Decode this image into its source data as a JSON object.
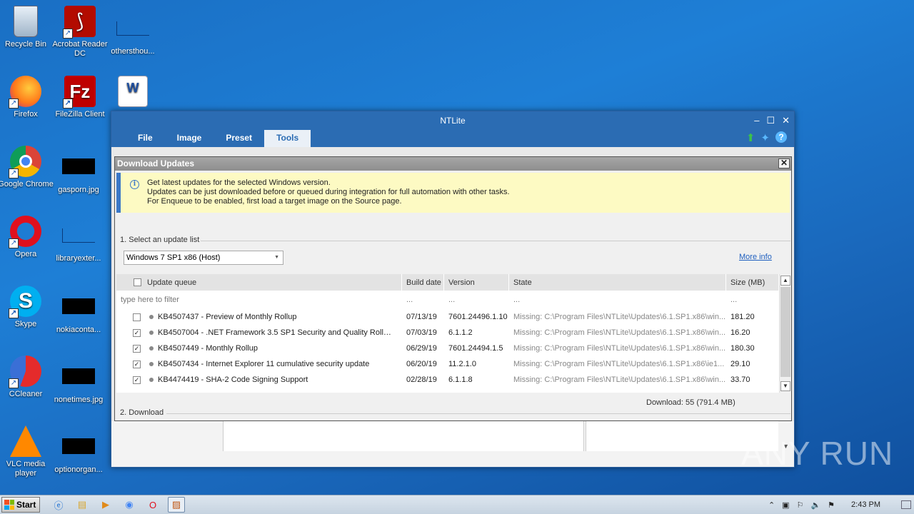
{
  "desktop": {
    "icons": [
      {
        "label": "Recycle Bin"
      },
      {
        "label": "Acrobat Reader DC"
      },
      {
        "label": "othersthou..."
      },
      {
        "label": "Firefox"
      },
      {
        "label": "FileZilla Client"
      },
      {
        "label": ""
      },
      {
        "label": "Google Chrome"
      },
      {
        "label": "gasporn.jpg"
      },
      {
        "label": "Opera"
      },
      {
        "label": "libraryexter..."
      },
      {
        "label": "Skype"
      },
      {
        "label": "nokiaconta..."
      },
      {
        "label": "CCleaner"
      },
      {
        "label": "nonetimes.jpg"
      },
      {
        "label": "VLC media player"
      },
      {
        "label": "optionorgan..."
      }
    ]
  },
  "ntlite": {
    "title": "NTLite",
    "tabs": [
      "File",
      "Image",
      "Preset",
      "Tools"
    ],
    "active_tab": "Tools"
  },
  "dialog": {
    "title": "Download Updates",
    "info_lines": [
      "Get latest updates for the selected Windows version.",
      "Updates can be just downloaded before or queued during integration for full automation with other tasks.",
      "For Enqueue to be enabled, first load a target image on the Source page."
    ],
    "section1": "1. Select an update list",
    "selected_list": "Windows 7 SP1 x86 (Host)",
    "more_info": "More info",
    "columns": [
      "Update queue",
      "Build date",
      "Version",
      "State",
      "Size (MB)"
    ],
    "filter_placeholder": "type here to filter",
    "filter_dots": "...",
    "rows": [
      {
        "checked": false,
        "name": "KB4507437 - Preview of Monthly Rollup",
        "date": "07/13/19",
        "version": "7601.24496.1.10",
        "state": "Missing: C:\\Program Files\\NTLite\\Updates\\6.1.SP1.x86\\win...",
        "size": "181.20"
      },
      {
        "checked": true,
        "name": "KB4507004 - .NET Framework 3.5 SP1 Security and Quality Rollup ...",
        "date": "07/03/19",
        "version": "6.1.1.2",
        "state": "Missing: C:\\Program Files\\NTLite\\Updates\\6.1.SP1.x86\\win...",
        "size": "16.20"
      },
      {
        "checked": true,
        "name": "KB4507449 - Monthly Rollup",
        "date": "06/29/19",
        "version": "7601.24494.1.5",
        "state": "Missing: C:\\Program Files\\NTLite\\Updates\\6.1.SP1.x86\\win...",
        "size": "180.30"
      },
      {
        "checked": true,
        "name": "KB4507434 - Internet Explorer 11 cumulative security update",
        "date": "06/20/19",
        "version": "11.2.1.0",
        "state": "Missing: C:\\Program Files\\NTLite\\Updates\\6.1.SP1.x86\\ie1...",
        "size": "29.10"
      },
      {
        "checked": true,
        "name": "KB4474419 - SHA-2 Code Signing Support",
        "date": "02/28/19",
        "version": "6.1.1.8",
        "state": "Missing: C:\\Program Files\\NTLite\\Updates\\6.1.SP1.x86\\win...",
        "size": "33.70"
      }
    ],
    "download_summary": "Download: 55 (791.4 MB)",
    "section2": "2. Download"
  },
  "taskbar": {
    "start_label": "Start",
    "clock": "2:43 PM"
  },
  "watermark": "ANY RUN"
}
